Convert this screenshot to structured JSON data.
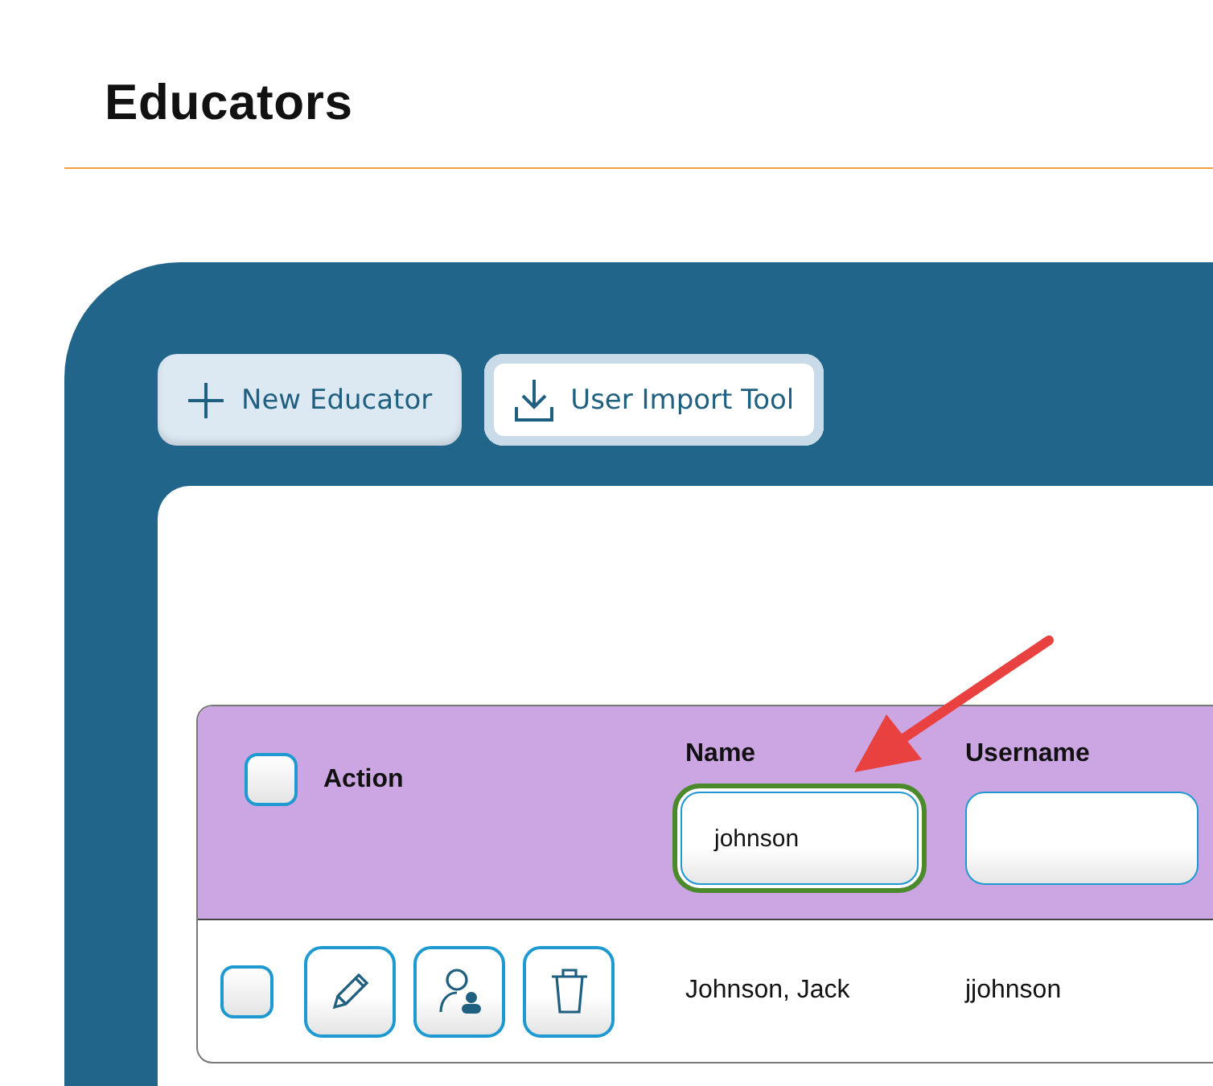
{
  "page": {
    "title": "Educators"
  },
  "toolbar": [
    {
      "kind": "add",
      "label": "New Educator",
      "selected": false
    },
    {
      "kind": "import",
      "label": "User Import Tool",
      "selected": true
    }
  ],
  "table": {
    "select_all": {
      "checked": false
    },
    "columns": [
      {
        "label": "Action"
      },
      {
        "label": "Name",
        "filter": {
          "value": "johnson",
          "focused": true
        }
      },
      {
        "label": "Username",
        "filter": {
          "focused": false
        }
      }
    ],
    "rows": [
      {
        "checked": false,
        "actions": [
          {
            "kind": "edit"
          },
          {
            "kind": "profile"
          },
          {
            "kind": "delete"
          }
        ],
        "name": "Johnson, Jack",
        "username": "jjohnson"
      }
    ]
  },
  "annotation": {
    "kind": "arrow"
  }
}
